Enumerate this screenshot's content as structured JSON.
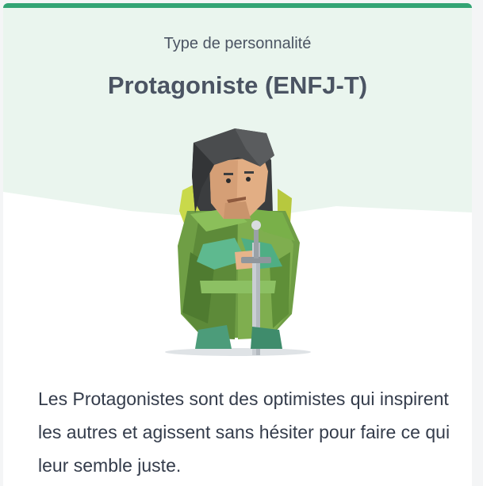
{
  "profile": {
    "eyebrow": "Type de personnalité",
    "title": "Protagoniste (ENFJ-T)",
    "description": "Les Protagonistes sont des optimistes qui inspirent les autres et agissent sans hésiter pour faire ce qui leur semble juste."
  },
  "avatar": {
    "icon": "protagonist-knight-icon"
  },
  "colors": {
    "accent": "#33a474",
    "hero_background": "#eaf5ee",
    "text": "#343c4b"
  }
}
